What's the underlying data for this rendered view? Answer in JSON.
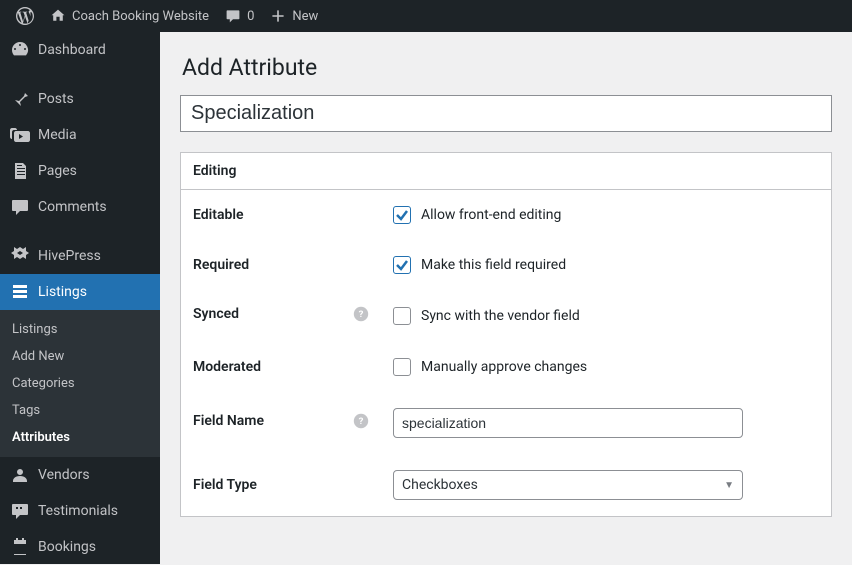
{
  "toolbar": {
    "site_name": "Coach Booking Website",
    "comments_count": "0",
    "new_label": "New"
  },
  "sidebar": {
    "items": [
      {
        "label": "Dashboard"
      },
      {
        "label": "Posts"
      },
      {
        "label": "Media"
      },
      {
        "label": "Pages"
      },
      {
        "label": "Comments"
      },
      {
        "label": "HivePress"
      },
      {
        "label": "Listings"
      },
      {
        "label": "Vendors"
      },
      {
        "label": "Testimonials"
      },
      {
        "label": "Bookings"
      }
    ],
    "submenu": [
      {
        "label": "Listings"
      },
      {
        "label": "Add New"
      },
      {
        "label": "Categories"
      },
      {
        "label": "Tags"
      },
      {
        "label": "Attributes"
      }
    ]
  },
  "page": {
    "title": "Add Attribute",
    "attr_title_value": "Specialization",
    "panel_header": "Editing",
    "rows": {
      "editable": {
        "label": "Editable",
        "check_label": "Allow front-end editing"
      },
      "required": {
        "label": "Required",
        "check_label": "Make this field required"
      },
      "synced": {
        "label": "Synced",
        "check_label": "Sync with the vendor field"
      },
      "moderated": {
        "label": "Moderated",
        "check_label": "Manually approve changes"
      },
      "field_name": {
        "label": "Field Name",
        "value": "specialization"
      },
      "field_type": {
        "label": "Field Type",
        "value": "Checkboxes"
      }
    }
  }
}
